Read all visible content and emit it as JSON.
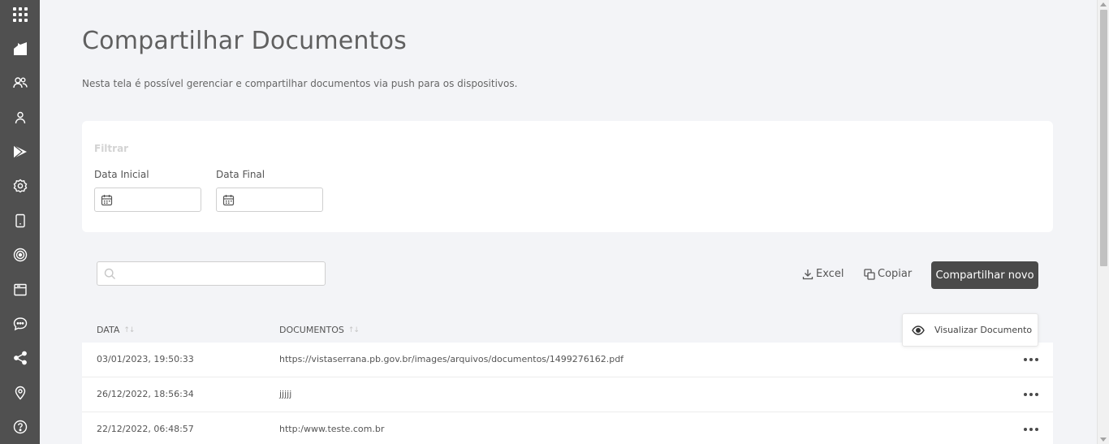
{
  "sidebar": {
    "items": [
      {
        "icon": "apps-grid-icon"
      },
      {
        "icon": "dashboard-icon"
      },
      {
        "icon": "users-icon"
      },
      {
        "icon": "user-icon"
      },
      {
        "icon": "play-store-icon"
      },
      {
        "icon": "settings-icon"
      },
      {
        "icon": "device-icon"
      },
      {
        "icon": "target-icon"
      },
      {
        "icon": "browser-window-icon"
      },
      {
        "icon": "chat-icon"
      },
      {
        "icon": "share-icon"
      },
      {
        "icon": "location-pin-icon"
      },
      {
        "icon": "help-icon"
      }
    ]
  },
  "page": {
    "title": "Compartilhar Documentos",
    "subtitle": "Nesta tela é possível gerenciar e compartilhar documentos via push para os dispositivos."
  },
  "filter": {
    "title": "Filtrar",
    "start_label": "Data Inicial",
    "end_label": "Data Final",
    "start_value": "",
    "end_value": ""
  },
  "toolbar": {
    "search_value": "",
    "excel_label": "Excel",
    "copy_label": "Copiar",
    "share_new_label": "Compartilhar novo"
  },
  "table": {
    "columns": [
      "DATA",
      "DOCUMENTOS"
    ],
    "rows": [
      {
        "date": "03/01/2023, 19:50:33",
        "document": "https://vistaserrana.pb.gov.br/images/arquivos/documentos/1499276162.pdf"
      },
      {
        "date": "26/12/2022, 18:56:34",
        "document": "jjjjj"
      },
      {
        "date": "22/12/2022, 06:48:57",
        "document": "http:/www.teste.com.br"
      }
    ]
  },
  "popover": {
    "label": "Visualizar Documento"
  }
}
